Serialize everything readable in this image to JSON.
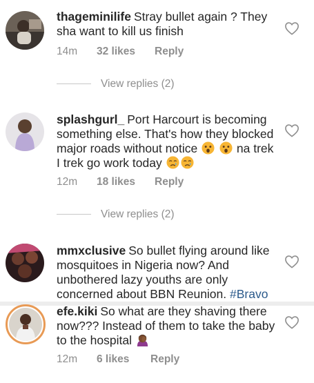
{
  "comments": [
    {
      "username": "thageminilife",
      "text": "Stray bullet again ? They sha want to kill us finish",
      "time": "14m",
      "likes": "32 likes",
      "reply": "Reply",
      "view_replies": "View replies (2)"
    },
    {
      "username": "splashgurl_",
      "text_1": "Port Harcourt is becoming something else. That's how they blocked major roads without notice",
      "text_2": "na trek I trek go work today",
      "emojis_line1": [
        "astonished-face"
      ],
      "emojis_line2_start": [
        "astonished-face"
      ],
      "emojis_end": [
        "crying-face",
        "crying-face"
      ],
      "time": "12m",
      "likes": "18 likes",
      "reply": "Reply",
      "view_replies": "View replies (2)"
    },
    {
      "username": "mmxclusive",
      "text": "So bullet flying around like mosquitoes in Nigeria now? And unbothered lazy youths are only concerned about BBN Reunion.",
      "hashtag": "#Bravo"
    },
    {
      "username": "efe.kiki",
      "text": "So what are they shaving there now??? Instead of them to take the baby to the hospital",
      "emoji_end": "woman-facepalming",
      "time": "12m",
      "likes": "6 likes",
      "reply": "Reply"
    }
  ],
  "icons": {
    "like": "heart-outline-icon"
  },
  "colors": {
    "text": "#262626",
    "meta": "#8e8e8e",
    "hashtag": "#2b5a8b",
    "story_ring": "#e89a55"
  }
}
